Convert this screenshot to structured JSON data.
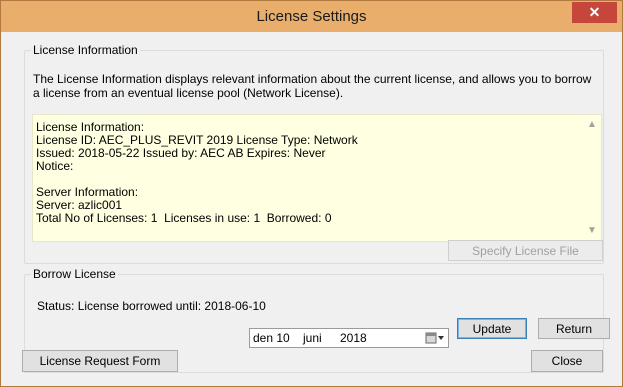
{
  "window": {
    "title": "License Settings",
    "close_glyph": "✕",
    "accent": "#e9ae6c",
    "close_color": "#c7463b"
  },
  "license_info": {
    "legend": "License Information",
    "description": "The License Information displays relevant information about the current license, and allows you to borrow a license from an eventual license pool (Network License).",
    "details": [
      "License Information:",
      "License ID: AEC_PLUS_REVIT 2019 License Type: Network",
      "Issued: 2018-05-22 Issued by: AEC AB Expires: Never",
      "Notice:",
      "",
      "Server Information:",
      "Server: azlic001",
      "Total No of Licenses: 1  Licenses in use: 1  Borrowed: 0"
    ],
    "info_bg": "#ffffe1",
    "specify_button": "Specify License File"
  },
  "borrow": {
    "legend": "Borrow License",
    "status": "Status: License borrowed until: 2018-06-10",
    "date": {
      "day": "den 10",
      "month": "juni",
      "year": "2018",
      "icon": "calendar-dropdown-icon"
    },
    "update_button": "Update",
    "return_button": "Return"
  },
  "footer": {
    "request_button": "License Request Form",
    "close_button": "Close"
  }
}
